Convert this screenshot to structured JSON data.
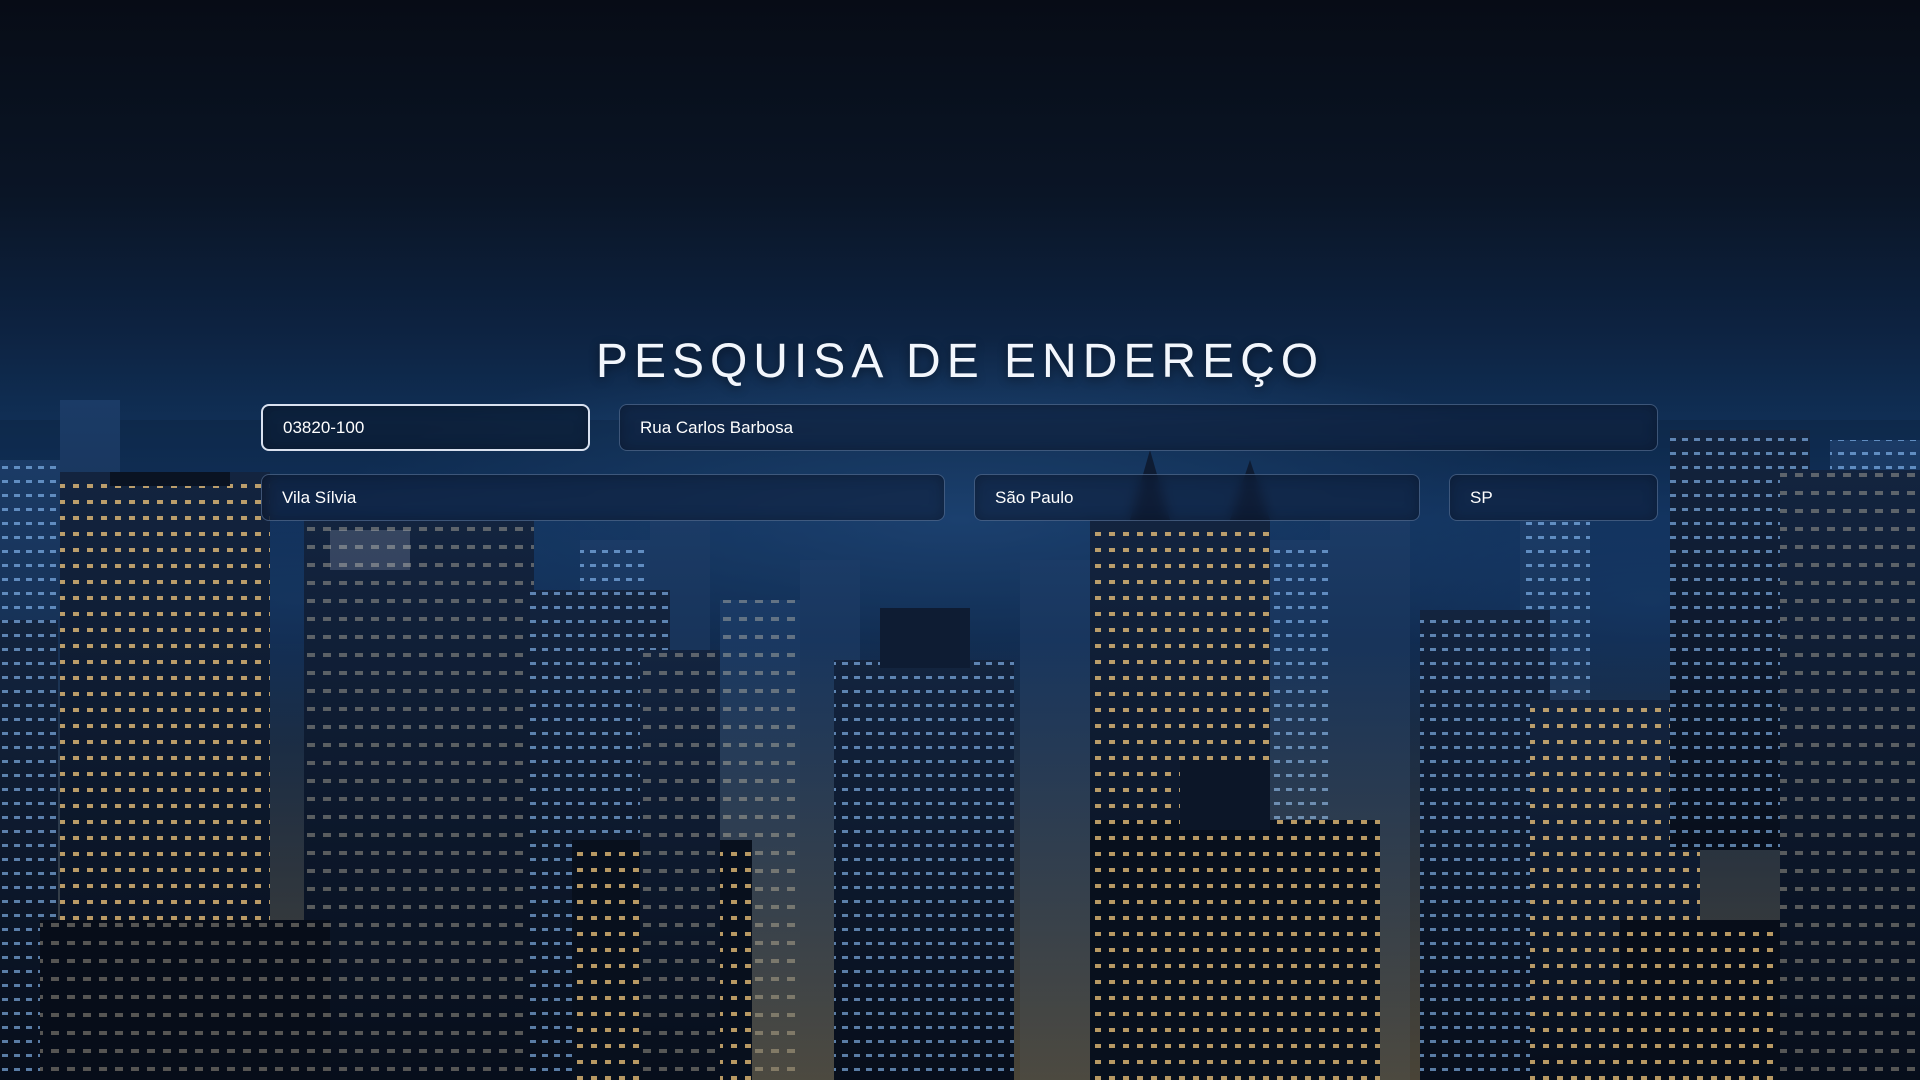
{
  "page": {
    "title": "PESQUISA DE ENDEREÇO",
    "background": "night-city-skyline"
  },
  "form": {
    "cep": {
      "value": "03820-100",
      "active": true
    },
    "rua": {
      "value": "Rua Carlos Barbosa"
    },
    "bairro": {
      "value": "Vila Sílvia"
    },
    "cidade": {
      "value": "São Paulo"
    },
    "uf": {
      "value": "SP"
    }
  },
  "colors": {
    "sky_top": "#070c16",
    "sky_mid": "#12386a",
    "window_warm": "#f3c77a",
    "window_cool": "#8fc4ff",
    "field_border": "#ebf2ff"
  }
}
